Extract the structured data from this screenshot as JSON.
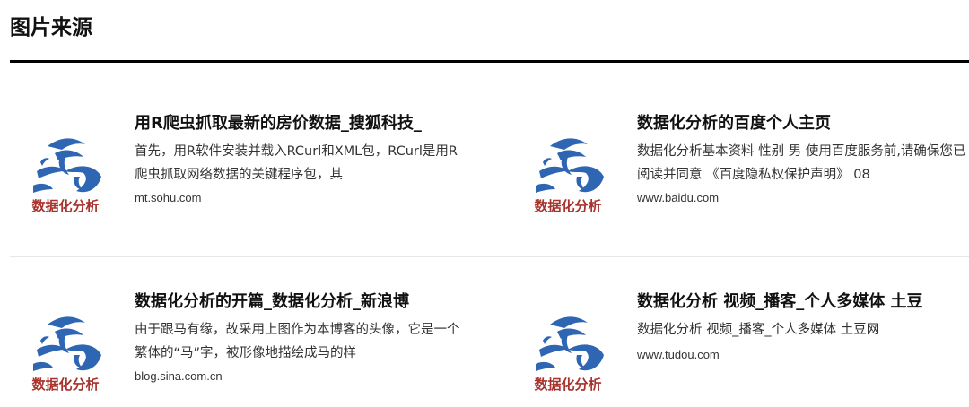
{
  "section": {
    "title": "图片来源"
  },
  "thumbnail": {
    "icon": "horse-calligraphy-logo",
    "caption": "数据化分析",
    "brush_color": "#2f66b3",
    "caption_color": "#a8322c"
  },
  "cards": [
    {
      "title": "用R爬虫抓取最新的房价数据_搜狐科技_",
      "snippet": "首先，用R软件安装并载入RCurl和XML包，RCurl是用R爬虫抓取网络数据的关键程序包，其",
      "url": "mt.sohu.com"
    },
    {
      "title": "数据化分析的百度个人主页",
      "snippet": "数据化分析基本资料 性别 男 使用百度服务前,请确保您已阅读并同意 《百度隐私权保护声明》 08",
      "url": "www.baidu.com"
    },
    {
      "title": "数据化分析的开篇_数据化分析_新浪博",
      "snippet": "由于跟马有缘，故采用上图作为本博客的头像，它是一个繁体的“马”字，被形像地描绘成马的样",
      "url": "blog.sina.com.cn"
    },
    {
      "title": "数据化分析 视频_播客_个人多媒体 土豆",
      "snippet": "数据化分析 视频_播客_个人多媒体 土豆网",
      "url": "www.tudou.com"
    }
  ]
}
